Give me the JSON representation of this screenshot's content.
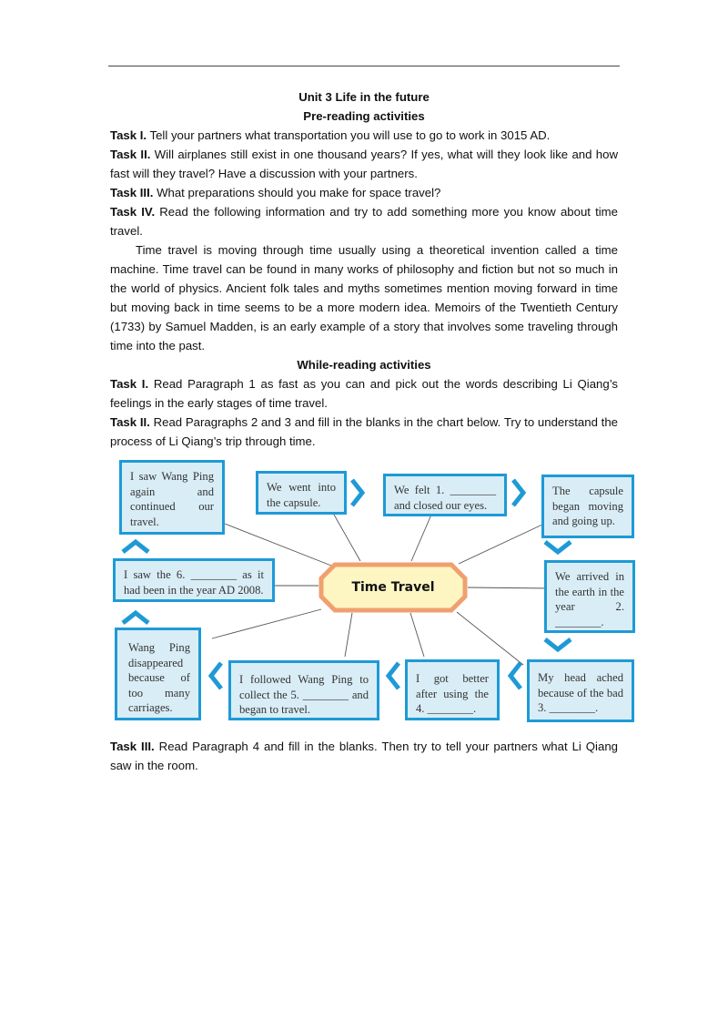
{
  "title": "Unit 3 Life in the future",
  "pre_reading": {
    "heading": "Pre-reading activities",
    "tasks": [
      {
        "label": "Task I.",
        "text": " Tell your partners what transportation you will use to go to work in 3015 AD."
      },
      {
        "label": "Task II.",
        "text": " Will airplanes still exist in one thousand years? If yes, what will they look like and how fast will they travel? Have a discussion with your partners."
      },
      {
        "label": "Task III.",
        "text": " What preparations should you make for space travel?"
      },
      {
        "label": "Task IV.",
        "text": " Read the following information and try to add something more you know about time travel."
      }
    ],
    "passage": "Time travel is moving through time usually using a theoretical invention called a time machine. Time travel can be found in many works of philosophy and fiction but not so much in the world of physics. Ancient folk tales and myths sometimes mention moving forward in time but moving back in time seems to be a more modern idea. Memoirs of the Twentieth Century (1733) by Samuel Madden, is an early example of a story that involves some traveling through time into the past."
  },
  "while_reading": {
    "heading": "While-reading activities",
    "tasks": [
      {
        "label": "Task I.",
        "text": " Read Paragraph 1 as fast as you can and pick out the words describing Li Qiang’s feelings in the early stages of time travel."
      },
      {
        "label": "Task II.",
        "text": " Read Paragraphs 2 and 3 and fill in the blanks in the chart below. Try to understand the process of Li Qiang’s trip through time."
      },
      {
        "label": "Task III.",
        "text": " Read Paragraph 4 and fill in the blanks. Then try to tell your partners what Li Qiang saw in the room."
      }
    ]
  },
  "diagram": {
    "center": "Time Travel",
    "colors": {
      "box_border": "#1e9ad6",
      "box_fill": "#d9edf6",
      "center_border": "#f0a070",
      "center_fill": "#fdf6c3"
    },
    "nodes": [
      {
        "id": "went-into-capsule",
        "text": "We went into the capsule."
      },
      {
        "id": "felt-blank-1",
        "text": "We felt 1. ________ and closed our eyes."
      },
      {
        "id": "capsule-moving",
        "text": "The capsule began moving and going up."
      },
      {
        "id": "arrived-blank-2",
        "text": "We arrived in the earth in the year 2. ________."
      },
      {
        "id": "head-ached-blank-3",
        "text": "My head ached because of the bad 3. ________."
      },
      {
        "id": "got-better-blank-4",
        "text": "I got better after using the 4. ________."
      },
      {
        "id": "followed-blank-5",
        "text": "I followed Wang Ping to collect the 5. ________ and began to travel."
      },
      {
        "id": "wang-ping-disappeared",
        "text": "Wang Ping disappeared because of too many carriages."
      },
      {
        "id": "saw-blank-6",
        "text": "I saw the 6. ________ as it had been in the year AD 2008."
      },
      {
        "id": "saw-wang-ping-again",
        "text": "I saw Wang Ping again and continued our travel."
      }
    ]
  }
}
